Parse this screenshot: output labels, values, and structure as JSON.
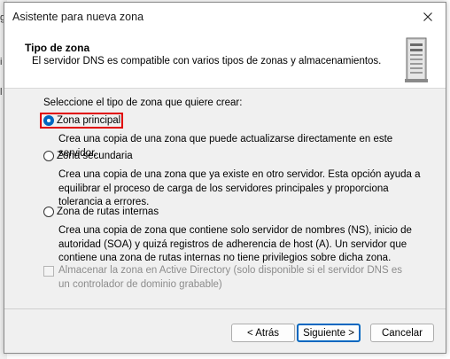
{
  "window": {
    "title": "Asistente para nueva zona",
    "close_icon": "close-icon"
  },
  "header": {
    "title": "Tipo de zona",
    "subtitle": "El servidor DNS es compatible con varios tipos de zonas y almacenamientos.",
    "icon": "server-icon"
  },
  "content": {
    "prompt": "Seleccione el tipo de zona que quiere crear:",
    "options": [
      {
        "label": "Zona principal",
        "checked": true,
        "description": "Crea una copia de una zona que puede actualizarse directamente en este servidor."
      },
      {
        "label": "Zona secundaria",
        "checked": false,
        "description": "Crea una copia de una zona que ya existe en otro servidor. Esta opción ayuda a equilibrar el proceso de carga de los servidores principales y proporciona tolerancia a errores."
      },
      {
        "label": "Zona de rutas internas",
        "checked": false,
        "description": "Crea una copia de zona que contiene solo servidor de nombres (NS), inicio de autoridad (SOA) y quizá registros de adherencia de host (A). Un servidor que contiene una zona de rutas internas no tiene privilegios sobre dicha zona."
      }
    ],
    "store_in_ad": {
      "label": "Almacenar la zona en Active Directory (solo disponible si el servidor DNS es un controlador de dominio grabable)",
      "checked": false,
      "disabled": true
    }
  },
  "buttons": {
    "back": "< Atrás",
    "next": "Siguiente >",
    "cancel": "Cancelar"
  },
  "colors": {
    "accent": "#0067c0",
    "highlight": "#e00000"
  }
}
